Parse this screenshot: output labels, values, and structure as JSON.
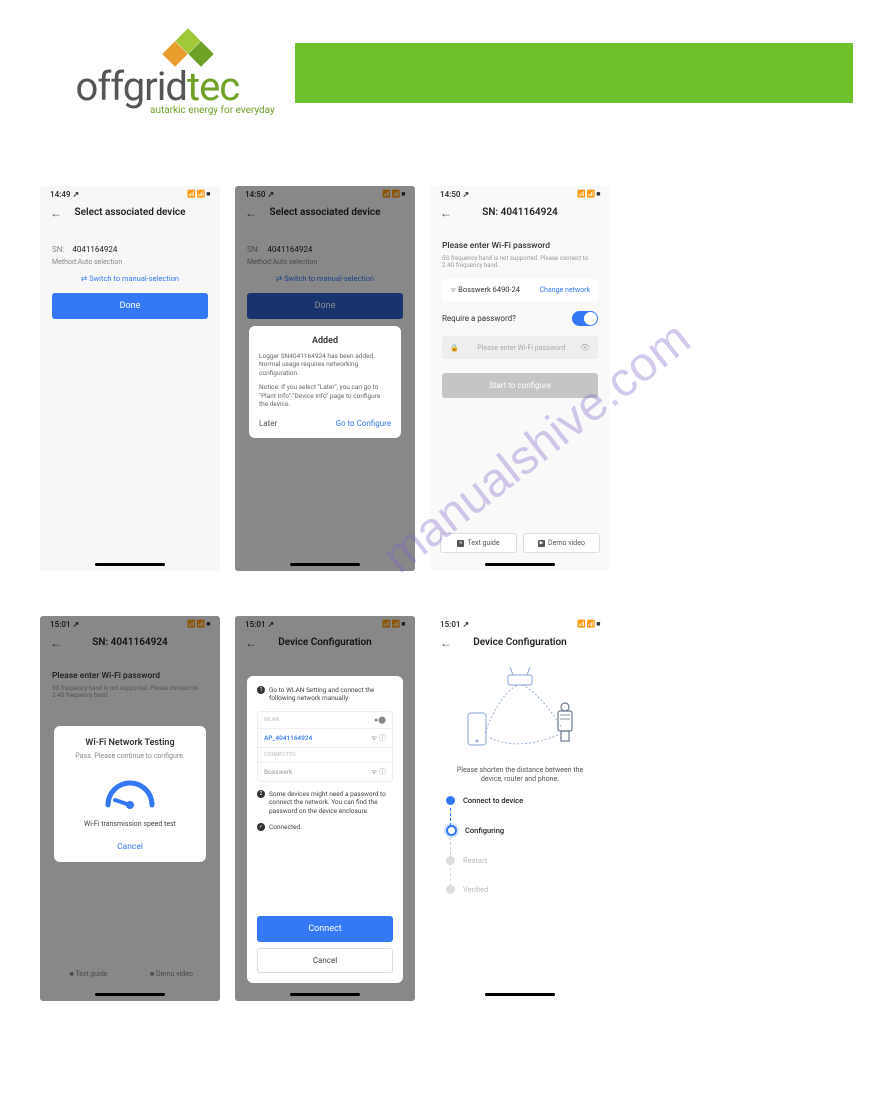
{
  "brand": {
    "name_part1": "offgrid",
    "name_part2": "tec",
    "tagline": "autarkic energy for everyday"
  },
  "watermark": "manualshive.com",
  "screens": {
    "s1": {
      "time": "14:49 ↗",
      "signal": "📶 📶 ■",
      "title": "Select associated device",
      "sn_label": "SN:",
      "sn_value": "4041164924",
      "method": "Method:Auto selection",
      "switch": "Switch to manual-selection",
      "done": "Done"
    },
    "s2": {
      "time": "14:50 ↗",
      "title": "Select associated device",
      "sn_label": "SN:",
      "sn_value": "4041164924",
      "method": "Method:Auto selection",
      "switch": "Switch to manual-selection",
      "done": "Done",
      "popup_title": "Added",
      "popup_line1": "Logger SN4041164924 has been added. Normal usage requires networking configuration.",
      "popup_line2": "Notice: If you select \"Later\", you can go to \"Plant Info\"-\"Device Info\" page to configure the device.",
      "later": "Later",
      "go": "Go to Configure"
    },
    "s3": {
      "time": "14:50 ↗",
      "title": "SN: 4041164924",
      "heading": "Please enter Wi-Fi password",
      "note": "5G frequency band is not supported. Please connect to 2.4G frequency band.",
      "wifi_name": "Bosswerk 6490-24",
      "change": "Change network",
      "require_pwd": "Require a password?",
      "placeholder": "Please enter Wi-Fi password",
      "start": "Start to configure",
      "text_guide": "Text guide",
      "demo_video": "Demo video"
    },
    "s4": {
      "time": "15:01 ↗",
      "title": "SN: 4041164924",
      "bg_heading": "Please enter Wi-Fi password",
      "popup_title": "Wi-Fi Network Testing",
      "pass": "Pass. Please continue to configure.",
      "speed_label": "Wi-Fi transmission speed test",
      "cancel": "Cancel",
      "text_guide": "Text guide",
      "demo_video": "Demo video"
    },
    "s5": {
      "time": "15:01 ↗",
      "title": "Device Configuration",
      "step1": "Go to WLAN Setting and connect the following network manually",
      "wlan_label": "WLAN",
      "ap": "AP_4041164924",
      "other_label": "CONNECTED",
      "other_val": "Bosswerk",
      "step2": "Some devices might need a password to connect the network. You can find the password on the device enclosure.",
      "step3": "Connected.",
      "connect": "Connect",
      "cancel": "Cancel"
    },
    "s6": {
      "time": "15:01 ↗",
      "title": "Device Configuration",
      "caption": "Please shorten the distance between the device, router and phone.",
      "steps": {
        "a": "Connect to device",
        "b": "Configuring",
        "c": "Restart",
        "d": "Verified"
      }
    }
  }
}
